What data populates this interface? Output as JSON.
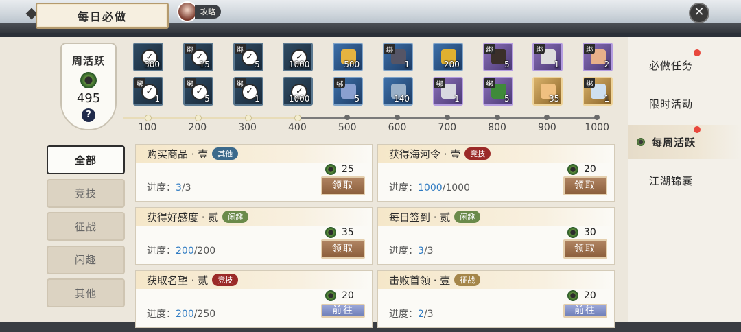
{
  "header": {
    "title": "每日必做",
    "guide_label": "攻略",
    "close_icon": "close-icon"
  },
  "weekly": {
    "title": "周活跃",
    "score": "495",
    "help": "?"
  },
  "rewards": [
    {
      "qty": "300",
      "claimed": true,
      "bound": false,
      "style": "r-dark"
    },
    {
      "qty": "15",
      "claimed": true,
      "bound": true,
      "style": "r-dark"
    },
    {
      "qty": "5",
      "claimed": true,
      "bound": true,
      "style": "r-dark"
    },
    {
      "qty": "1000",
      "claimed": true,
      "bound": false,
      "style": "r-dark"
    },
    {
      "qty": "500",
      "claimed": false,
      "bound": false,
      "style": "r-blue",
      "art": "#e6b340"
    },
    {
      "qty": "1",
      "claimed": false,
      "bound": true,
      "style": "r-blue",
      "art": "#556"
    },
    {
      "qty": "200",
      "claimed": false,
      "bound": false,
      "style": "r-blue",
      "art": "#e0b030"
    },
    {
      "qty": "5",
      "claimed": false,
      "bound": true,
      "style": "r-purple",
      "art": "#3a2f2a"
    },
    {
      "qty": "1",
      "claimed": false,
      "bound": true,
      "style": "r-purple",
      "art": "#ddd"
    },
    {
      "qty": "2",
      "claimed": false,
      "bound": true,
      "style": "r-purple",
      "art": "#e8b08a"
    },
    {
      "qty": "1",
      "claimed": true,
      "bound": true,
      "style": "r-dark"
    },
    {
      "qty": "5",
      "claimed": true,
      "bound": true,
      "style": "r-dark"
    },
    {
      "qty": "1",
      "claimed": true,
      "bound": true,
      "style": "r-dark"
    },
    {
      "qty": "1000",
      "claimed": true,
      "bound": false,
      "style": "r-dark"
    },
    {
      "qty": "5",
      "claimed": false,
      "bound": true,
      "style": "r-blue",
      "art": "#8aa0d0"
    },
    {
      "qty": "140",
      "claimed": false,
      "bound": false,
      "style": "r-blue",
      "art": "#9ab0c8"
    },
    {
      "qty": "1",
      "claimed": false,
      "bound": true,
      "style": "r-purple",
      "art": "#d8d8e0"
    },
    {
      "qty": "5",
      "claimed": false,
      "bound": true,
      "style": "r-purple",
      "art": "#3f8a3a"
    },
    {
      "qty": "35",
      "claimed": false,
      "bound": false,
      "style": "r-gold",
      "art": "#f0c080"
    },
    {
      "qty": "1",
      "claimed": false,
      "bound": true,
      "style": "r-gold",
      "art": "#cfe0f0"
    }
  ],
  "bind_label": "绑",
  "milestones": [
    "100",
    "200",
    "300",
    "400",
    "500",
    "600",
    "700",
    "800",
    "900",
    "1000"
  ],
  "categories": [
    "全部",
    "竞技",
    "征战",
    "闲趣",
    "其他"
  ],
  "progress_label": "进度：",
  "tasks": [
    {
      "name": "购买商品 · 壹",
      "tag": "其他",
      "tag_class": "t-other",
      "points": "25",
      "cur": "3",
      "total": "/3",
      "button": "领取"
    },
    {
      "name": "获得海河令 · 壹",
      "tag": "竞技",
      "tag_class": "t-compete",
      "points": "20",
      "cur": "1000",
      "total": "/1000",
      "button": "领取"
    },
    {
      "name": "获得好感度 · 贰",
      "tag": "闲趣",
      "tag_class": "t-leisure",
      "points": "35",
      "cur": "200",
      "total": "/200",
      "button": "领取"
    },
    {
      "name": "每日签到 · 贰",
      "tag": "闲趣",
      "tag_class": "t-leisure",
      "points": "30",
      "cur": "3",
      "total": "/3",
      "button": "领取"
    },
    {
      "name": "获取名望 · 贰",
      "tag": "竞技",
      "tag_class": "t-compete",
      "points": "20",
      "cur": "200",
      "total": "/250",
      "button": "前往"
    },
    {
      "name": "击败首领 · 壹",
      "tag": "征战",
      "tag_class": "t-battle",
      "points": "20",
      "cur": "2",
      "total": "/3",
      "button": "前往"
    }
  ],
  "right_tabs": [
    {
      "label": "必做任务",
      "dot": true
    },
    {
      "label": "限时活动",
      "dot": false
    },
    {
      "label": "每周活跃",
      "dot": true,
      "active": true
    },
    {
      "label": "江湖锦囊",
      "dot": false
    }
  ],
  "colors": {
    "accent_red": "#e8483d",
    "progress_blue": "#2f7bc2",
    "claim_brown": "#8c5f3c"
  }
}
